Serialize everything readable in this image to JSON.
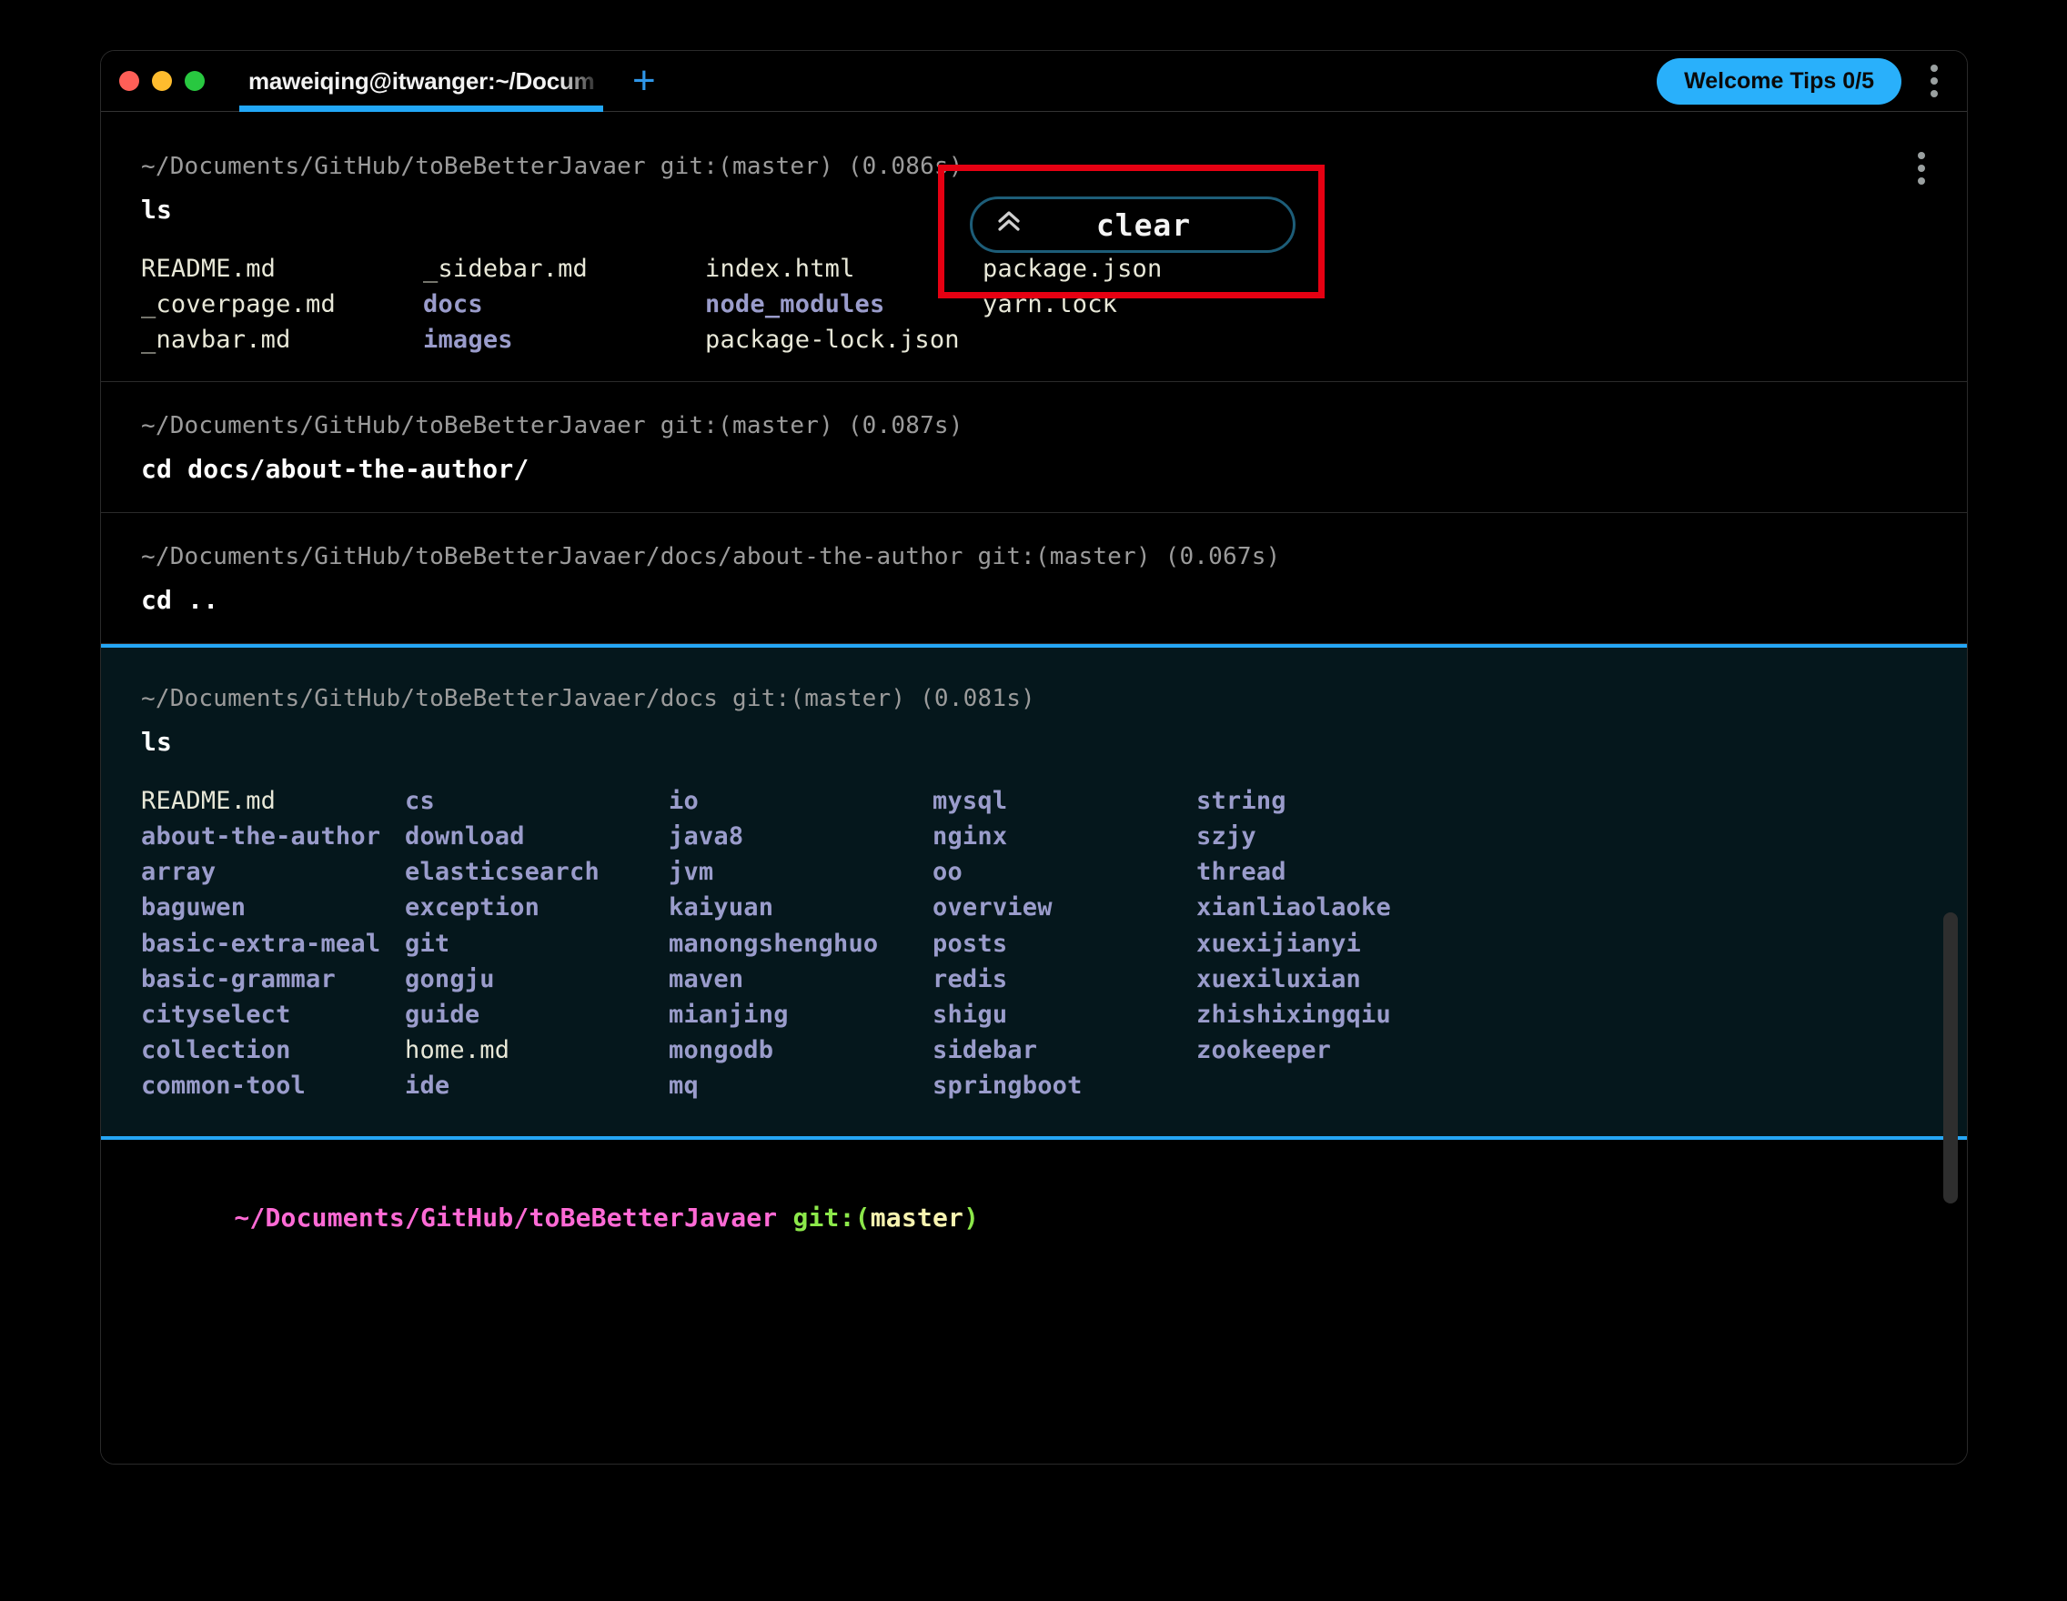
{
  "window": {
    "traffic_lights": [
      "close",
      "minimize",
      "maximize"
    ],
    "tab_title": "maweiqing@itwanger:~/Docum",
    "new_tab_label": "+",
    "tips_badge": "Welcome Tips 0/5",
    "kebab_label": "⋮"
  },
  "overlay": {
    "clear_button_label": "clear",
    "clear_chevron": "⌃⌃",
    "annotation_color": "#e60012",
    "accent_color": "#25a6f5",
    "badge_color": "#29b0fb"
  },
  "blocks": [
    {
      "prompt": "~/Documents/GitHub/toBeBetterJavaer git:(master) (0.086s)",
      "command": "ls",
      "selected": false,
      "has_kebab": true,
      "columns": 4,
      "entries": [
        {
          "name": "README.md",
          "type": "file"
        },
        {
          "name": "_sidebar.md",
          "type": "file"
        },
        {
          "name": "index.html",
          "type": "file"
        },
        {
          "name": "package.json",
          "type": "file"
        },
        {
          "name": "_coverpage.md",
          "type": "file"
        },
        {
          "name": "docs",
          "type": "dir"
        },
        {
          "name": "node_modules",
          "type": "dir"
        },
        {
          "name": "yarn.lock",
          "type": "file"
        },
        {
          "name": "_navbar.md",
          "type": "file"
        },
        {
          "name": "images",
          "type": "dir"
        },
        {
          "name": "package-lock.json",
          "type": "file"
        },
        {
          "name": "",
          "type": "file"
        }
      ]
    },
    {
      "prompt": "~/Documents/GitHub/toBeBetterJavaer git:(master) (0.087s)",
      "command": "cd docs/about-the-author/",
      "selected": false,
      "has_kebab": false,
      "columns": 0,
      "entries": []
    },
    {
      "prompt": "~/Documents/GitHub/toBeBetterJavaer/docs/about-the-author git:(master) (0.067s)",
      "command": "cd ..",
      "selected": false,
      "has_kebab": false,
      "columns": 0,
      "entries": []
    },
    {
      "prompt": "~/Documents/GitHub/toBeBetterJavaer/docs git:(master) (0.081s)",
      "command": "ls",
      "selected": true,
      "has_kebab": false,
      "columns": 5,
      "entries": [
        {
          "name": "README.md",
          "type": "file"
        },
        {
          "name": "cs",
          "type": "dir"
        },
        {
          "name": "io",
          "type": "dir"
        },
        {
          "name": "mysql",
          "type": "dir"
        },
        {
          "name": "string",
          "type": "dir"
        },
        {
          "name": "about-the-author",
          "type": "dir"
        },
        {
          "name": "download",
          "type": "dir"
        },
        {
          "name": "java8",
          "type": "dir"
        },
        {
          "name": "nginx",
          "type": "dir"
        },
        {
          "name": "szjy",
          "type": "dir"
        },
        {
          "name": "array",
          "type": "dir"
        },
        {
          "name": "elasticsearch",
          "type": "dir"
        },
        {
          "name": "jvm",
          "type": "dir"
        },
        {
          "name": "oo",
          "type": "dir"
        },
        {
          "name": "thread",
          "type": "dir"
        },
        {
          "name": "baguwen",
          "type": "dir"
        },
        {
          "name": "exception",
          "type": "dir"
        },
        {
          "name": "kaiyuan",
          "type": "dir"
        },
        {
          "name": "overview",
          "type": "dir"
        },
        {
          "name": "xianliaolaoke",
          "type": "dir"
        },
        {
          "name": "basic-extra-meal",
          "type": "dir"
        },
        {
          "name": "git",
          "type": "dir"
        },
        {
          "name": "manongshenghuo",
          "type": "dir"
        },
        {
          "name": "posts",
          "type": "dir"
        },
        {
          "name": "xuexijianyi",
          "type": "dir"
        },
        {
          "name": "basic-grammar",
          "type": "dir"
        },
        {
          "name": "gongju",
          "type": "dir"
        },
        {
          "name": "maven",
          "type": "dir"
        },
        {
          "name": "redis",
          "type": "dir"
        },
        {
          "name": "xuexiluxian",
          "type": "dir"
        },
        {
          "name": "cityselect",
          "type": "dir"
        },
        {
          "name": "guide",
          "type": "dir"
        },
        {
          "name": "mianjing",
          "type": "dir"
        },
        {
          "name": "shigu",
          "type": "dir"
        },
        {
          "name": "zhishixingqiu",
          "type": "dir"
        },
        {
          "name": "collection",
          "type": "dir"
        },
        {
          "name": "home.md",
          "type": "file"
        },
        {
          "name": "mongodb",
          "type": "dir"
        },
        {
          "name": "sidebar",
          "type": "dir"
        },
        {
          "name": "zookeeper",
          "type": "dir"
        },
        {
          "name": "common-tool",
          "type": "dir"
        },
        {
          "name": "ide",
          "type": "dir"
        },
        {
          "name": "mq",
          "type": "dir"
        },
        {
          "name": "springboot",
          "type": "dir"
        },
        {
          "name": "",
          "type": "file"
        }
      ]
    }
  ],
  "final_prompt": {
    "path": "~/Documents/GitHub/toBeBetterJavaer ",
    "git_open": "git:(",
    "branch": "master",
    "git_close": ")"
  }
}
